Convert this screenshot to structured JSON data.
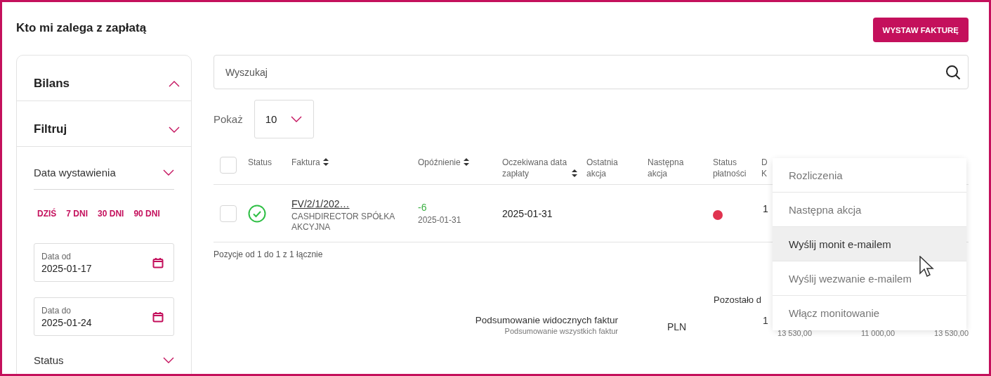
{
  "page": {
    "title": "Kto mi zalega z zapłatą",
    "primary_button": "WYSTAW FAKTURĘ"
  },
  "sidebar": {
    "sections": [
      {
        "title": "Bilans",
        "expanded": true
      },
      {
        "title": "Filtruj",
        "expanded": false
      }
    ],
    "date_filter": {
      "label": "Data wystawienia",
      "quick_ranges": [
        "DZIŚ",
        "7 DNI",
        "30 DNI",
        "90 DNI"
      ],
      "fields": [
        {
          "label": "Data od",
          "value": "2025-01-17"
        },
        {
          "label": "Data do",
          "value": "2025-01-24"
        }
      ]
    },
    "status_filter": {
      "label": "Status"
    }
  },
  "search": {
    "placeholder": "Wyszukaj"
  },
  "page_size": {
    "label": "Pokaż",
    "value": "10"
  },
  "table": {
    "select_all": {
      "checked": false
    },
    "columns": [
      {
        "label": "Status",
        "sortable": false
      },
      {
        "label": "Faktura",
        "sortable": true
      },
      {
        "label": "Opóźnienie",
        "sortable": true
      },
      {
        "label": "Oczekiwana data zapłaty",
        "sortable": true
      },
      {
        "label": "Ostatnia akcja",
        "sortable": false
      },
      {
        "label": "Następna akcja",
        "sortable": false
      },
      {
        "label": "Status płatności",
        "sortable": false
      },
      {
        "label": "D K",
        "sortable": false
      }
    ],
    "rows": [
      {
        "checked": false,
        "status": {
          "kind": "paid"
        },
        "invoice": "FV/2/1/202…",
        "client": "CASHDIRECTOR SPÓŁKA AKCYJNA",
        "delay": "-6",
        "delay_date": "2025-01-31",
        "expected_date": "2025-01-31",
        "payment_status": {
          "color": "#e0334f"
        },
        "column_9": "1"
      }
    ],
    "footer": "Pozycje od 1 do 1 z 1 łącznie"
  },
  "summary": {
    "remaining_header": "Pozostało d",
    "visible_label": "Podsumowanie widocznych faktur",
    "all_label": "Podsumowanie wszystkich faktur",
    "currency": "PLN",
    "visible_values": [
      "1"
    ],
    "all_values": [
      "13 530,00",
      "11 000,00",
      "13 530,00"
    ]
  },
  "context_menu": {
    "items": [
      {
        "label": "Rozliczenia",
        "selected": false
      },
      {
        "label": "Następna akcja",
        "selected": false
      },
      {
        "label": "Wyślij monit e-mailem",
        "selected": true
      },
      {
        "label": "Wyślij wezwanie e-mailem",
        "selected": false
      },
      {
        "label": "Włącz monitowanie",
        "selected": false
      }
    ]
  }
}
